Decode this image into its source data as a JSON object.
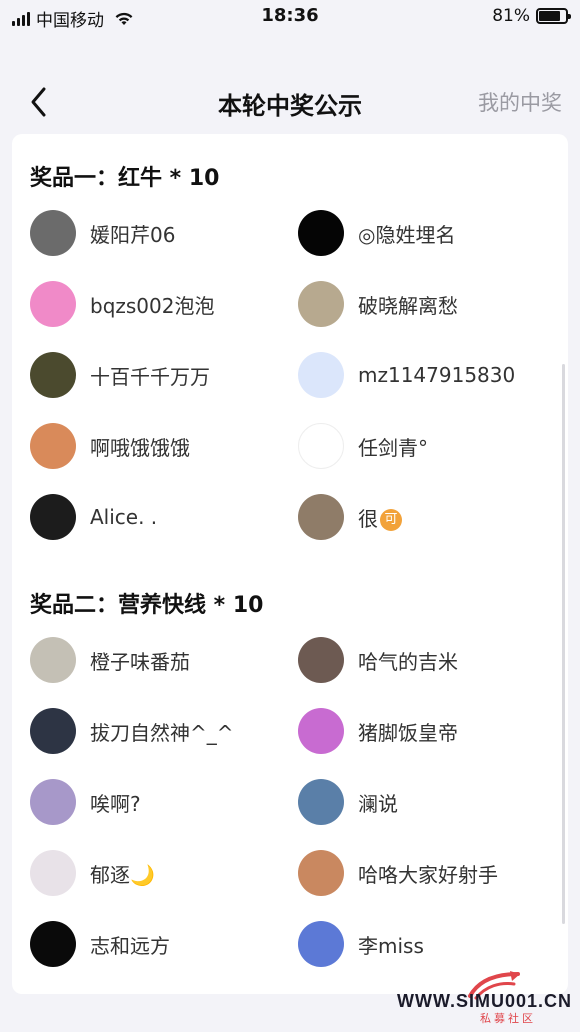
{
  "status_bar": {
    "carrier": "中国移动",
    "time": "18:36",
    "battery_text": "81%",
    "battery_level": 0.81
  },
  "nav": {
    "back_icon": "chevron-left-icon",
    "title": "本轮中奖公示",
    "right_link": "我的中奖"
  },
  "prizes": [
    {
      "title": "奖品一：红牛 * 10",
      "winners": [
        {
          "name": "媛阳芹06",
          "avatar_color": "#6b6b6b"
        },
        {
          "name": "◎隐姓埋名",
          "avatar_color": "#050505"
        },
        {
          "name": "bqzs002泡泡",
          "avatar_color": "#f08ac8"
        },
        {
          "name": "破晓解离愁",
          "avatar_color": "#b7a98f"
        },
        {
          "name": "十百千千万万",
          "avatar_color": "#4b4a2e"
        },
        {
          "name": "mz1147915830",
          "avatar_color": "#dbe6fb"
        },
        {
          "name": "啊哦饿饿饿",
          "avatar_color": "#d98a5a"
        },
        {
          "name": "任剑青°",
          "avatar_color": "#ffffff"
        },
        {
          "name": "Alice. .",
          "avatar_color": "#1c1c1c"
        },
        {
          "name": "很",
          "avatar_color": "#8f7c68",
          "badge": "可"
        }
      ]
    },
    {
      "title": "奖品二：营养快线 * 10",
      "winners": [
        {
          "name": "橙子味番茄",
          "avatar_color": "#c4c0b5"
        },
        {
          "name": "哈气的吉米",
          "avatar_color": "#6d5a52"
        },
        {
          "name": "拔刀自然神^_^",
          "avatar_color": "#2d3444"
        },
        {
          "name": "猪脚饭皇帝",
          "avatar_color": "#c86bd1"
        },
        {
          "name": "唉啊?",
          "avatar_color": "#a798c9"
        },
        {
          "name": "澜说",
          "avatar_color": "#5a7fa8"
        },
        {
          "name": "郁逐",
          "avatar_color": "#e8e2e8",
          "emoji": "🌙"
        },
        {
          "name": "哈咯大家好射手",
          "avatar_color": "#c98860"
        },
        {
          "name": "志和远方",
          "avatar_color": "#0a0a0a"
        },
        {
          "name": "李miss",
          "avatar_color": "#5c79d6"
        }
      ]
    }
  ],
  "watermark": {
    "text": "WWW.SIMU001.CN",
    "subtext": "私募社区"
  }
}
